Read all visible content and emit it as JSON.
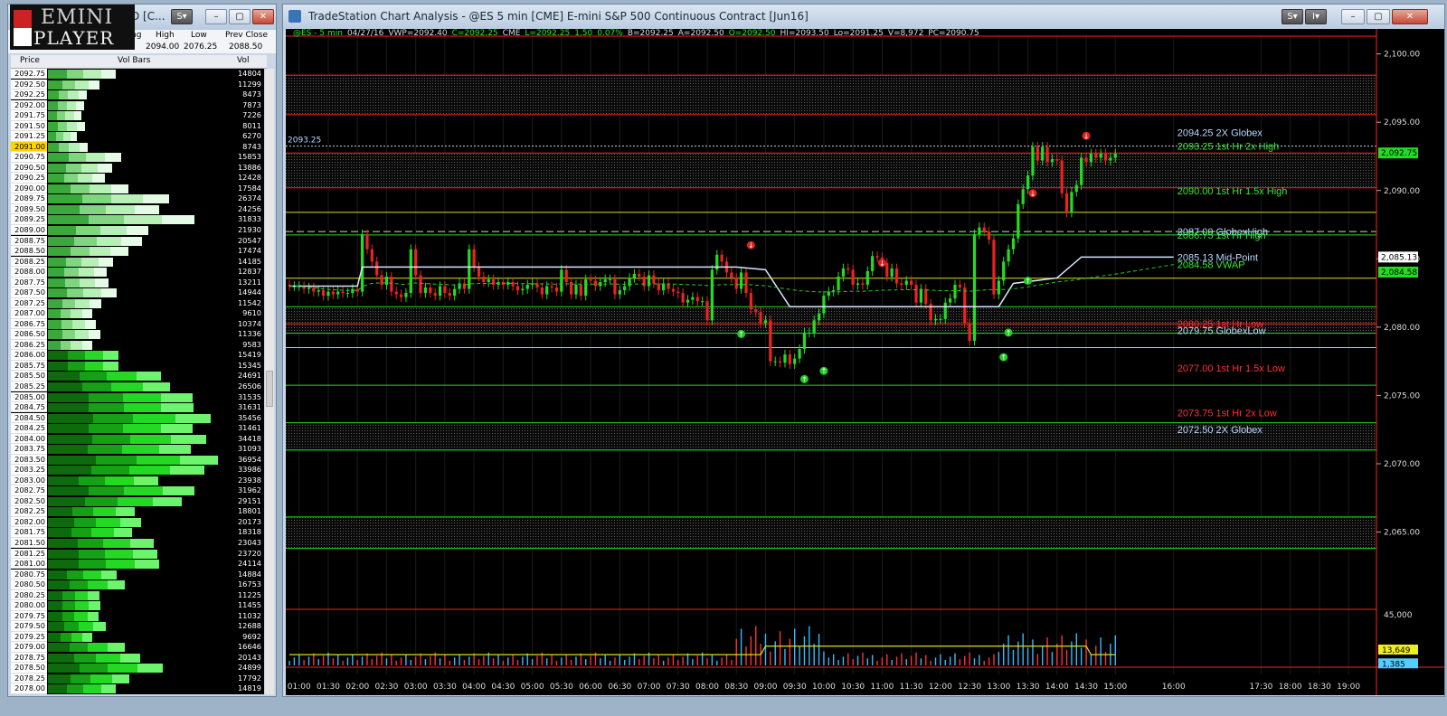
{
  "matrix_window": {
    "title_fragment": "D [C...",
    "logo": {
      "line1": "EMINI",
      "line2": "PLAYER"
    },
    "stats": {
      "chg_label": "hg",
      "high_label": "High",
      "low_label": "Low",
      "prev_label": "Prev Close",
      "high": "2094.00",
      "low": "2076.25",
      "prev": "2088.50"
    },
    "columns": {
      "price": "Price",
      "bars": "Vol Bars",
      "vol": "Vol"
    },
    "highlight_price": "2091.00",
    "rows": [
      [
        "2092.75",
        "14804"
      ],
      [
        "2092.50",
        "11299"
      ],
      [
        "2092.25",
        "8473"
      ],
      [
        "2092.00",
        "7873"
      ],
      [
        "2091.75",
        "7226"
      ],
      [
        "2091.50",
        "8011"
      ],
      [
        "2091.25",
        "6270"
      ],
      [
        "2091.00",
        "8743"
      ],
      [
        "2090.75",
        "15853"
      ],
      [
        "2090.50",
        "13886"
      ],
      [
        "2090.25",
        "12428"
      ],
      [
        "2090.00",
        "17584"
      ],
      [
        "2089.75",
        "26374"
      ],
      [
        "2089.50",
        "24256"
      ],
      [
        "2089.25",
        "31833"
      ],
      [
        "2089.00",
        "21930"
      ],
      [
        "2088.75",
        "20547"
      ],
      [
        "2088.50",
        "17474"
      ],
      [
        "2088.25",
        "14185"
      ],
      [
        "2088.00",
        "12837"
      ],
      [
        "2087.75",
        "13211"
      ],
      [
        "2087.50",
        "14944"
      ],
      [
        "2087.25",
        "11542"
      ],
      [
        "2087.00",
        "9610"
      ],
      [
        "2086.75",
        "10374"
      ],
      [
        "2086.50",
        "11336"
      ],
      [
        "2086.25",
        "9583"
      ],
      [
        "2086.00",
        "15419"
      ],
      [
        "2085.75",
        "15345"
      ],
      [
        "2085.50",
        "24691"
      ],
      [
        "2085.25",
        "26506"
      ],
      [
        "2085.00",
        "31535"
      ],
      [
        "2084.75",
        "31631"
      ],
      [
        "2084.50",
        "35456"
      ],
      [
        "2084.25",
        "31461"
      ],
      [
        "2084.00",
        "34418"
      ],
      [
        "2083.75",
        "31093"
      ],
      [
        "2083.50",
        "36954"
      ],
      [
        "2083.25",
        "33986"
      ],
      [
        "2083.00",
        "23938"
      ],
      [
        "2082.75",
        "31962"
      ],
      [
        "2082.50",
        "29151"
      ],
      [
        "2082.25",
        "18801"
      ],
      [
        "2082.00",
        "20173"
      ],
      [
        "2081.75",
        "18318"
      ],
      [
        "2081.50",
        "23043"
      ],
      [
        "2081.25",
        "23720"
      ],
      [
        "2081.00",
        "24114"
      ],
      [
        "2080.75",
        "14884"
      ],
      [
        "2080.50",
        "16753"
      ],
      [
        "2080.25",
        "11225"
      ],
      [
        "2080.00",
        "11455"
      ],
      [
        "2079.75",
        "11032"
      ],
      [
        "2079.50",
        "12688"
      ],
      [
        "2079.25",
        "9692"
      ],
      [
        "2079.00",
        "16646"
      ],
      [
        "2078.75",
        "20143"
      ],
      [
        "2078.50",
        "24899"
      ],
      [
        "2078.25",
        "17792"
      ],
      [
        "2078.00",
        "14819"
      ]
    ]
  },
  "chart_window": {
    "title": "TradeStation Chart Analysis - @ES 5 min [CME] E-mini S&P 500 Continuous Contract [Jun16]",
    "status_line": {
      "sym": "@ES - 5 min",
      "date": "04/27/16",
      "vwp": "VWP=2092.40",
      "c": "C=2092.25",
      "exch": "CME",
      "l": "L=2092.25",
      "chg": "1.50",
      "pct": "0.07%",
      "b": "B=2092.25",
      "a": "A=2092.50",
      "o": "O=2092.50",
      "hi": "HI=2093.50",
      "lo": "Lo=2091.25",
      "v": "V=8,972",
      "pc": "PC=2090.75"
    },
    "left_tag": "2093.25",
    "price_axis": [
      "2,100.00",
      "2,095.00",
      "2,090.00",
      "2,085.00",
      "2,080.00",
      "2,075.00",
      "2,070.00",
      "2,065.00"
    ],
    "price_tags": {
      "last": "2,092.75",
      "mid": "2,085.13",
      "vwap": "2,084.58"
    },
    "volume_axis": {
      "top": "45,000",
      "v1": "13,649",
      "v2": "1,385"
    },
    "time_axis": [
      "01:00",
      "01:30",
      "02:00",
      "02:30",
      "03:00",
      "03:30",
      "04:00",
      "04:30",
      "05:00",
      "05:30",
      "06:00",
      "06:30",
      "07:00",
      "07:30",
      "08:00",
      "08:30",
      "09:00",
      "09:30",
      "10:00",
      "10:30",
      "11:00",
      "11:30",
      "12:00",
      "12:30",
      "13:00",
      "13:30",
      "14:00",
      "14:30",
      "15:00",
      "16:00",
      "17:30",
      "18:00",
      "18:30",
      "19:00"
    ],
    "levels": [
      {
        "text": "2094.25 2X Globex",
        "color": "#b8d8ff"
      },
      {
        "text": "2093.25 1st Hr  2x High",
        "color": "#33ee33"
      },
      {
        "text": "2090.00 1st Hr  1.5x High",
        "color": "#33ee33"
      },
      {
        "text": "2087.00 GlobexHigh",
        "color": "#b8d8ff"
      },
      {
        "text": "2086.75 1st Hr  High",
        "color": "#33ee33"
      },
      {
        "text": "2085.13 Mid-Point",
        "color": "#b8d8ff"
      },
      {
        "text": "2084.58 VWAP",
        "color": "#33ee33"
      },
      {
        "text": "2080.25 1st Hr  Low",
        "color": "#ff3030"
      },
      {
        "text": "2079.75 GlobexLow",
        "color": "#b8d8ff"
      },
      {
        "text": "2077.00 1st Hr  1.5x Low",
        "color": "#ff3030"
      },
      {
        "text": "2073.75 1st Hr  2x Low",
        "color": "#ff3030"
      },
      {
        "text": "2072.50 2X Globex",
        "color": "#b8d8ff"
      }
    ]
  },
  "chart_data": {
    "type": "candlestick",
    "title": "TradeStation Chart Analysis - @ES 5 min [CME] E-mini S&P 500 Continuous Contract [Jun16]",
    "xlabel": "",
    "ylabel": "",
    "ylim": [
      2060.8,
      2101.3
    ],
    "x_range": [
      "00:50",
      "19:25"
    ],
    "bar_minutes": 5,
    "first_bar_time": "00:50",
    "last_bar_time": "15:10",
    "up_color": "#22dd22",
    "down_color": "#ee2222",
    "closes": [
      2083.0,
      2083.0,
      2083.0,
      2082.8,
      2082.9,
      2082.6,
      2082.7,
      2082.3,
      2082.6,
      2082.4,
      2082.6,
      2082.5,
      2082.5,
      2082.8,
      2082.6,
      2086.8,
      2085.7,
      2084.8,
      2083.8,
      2083.1,
      2083.7,
      2082.6,
      2082.4,
      2082.2,
      2082.5,
      2085.7,
      2083.8,
      2082.5,
      2082.9,
      2082.5,
      2082.3,
      2083.0,
      2082.5,
      2082.3,
      2082.8,
      2083.2,
      2082.8,
      2085.7,
      2084.4,
      2083.7,
      2083.3,
      2083.5,
      2083.1,
      2083.3,
      2083.1,
      2083.3,
      2083.0,
      2082.7,
      2082.8,
      2083.1,
      2083.2,
      2082.9,
      2082.4,
      2083.0,
      2082.9,
      2082.6,
      2084.2,
      2083.3,
      2082.4,
      2083.1,
      2082.3,
      2083.5,
      2083.4,
      2083.0,
      2083.3,
      2083.5,
      2083.5,
      2082.4,
      2082.7,
      2083.0,
      2083.6,
      2083.9,
      2083.7,
      2083.0,
      2083.8,
      2083.2,
      2082.7,
      2083.2,
      2082.8,
      2082.6,
      2082.5,
      2081.8,
      2082.0,
      2082.2,
      2081.9,
      2081.9,
      2080.5,
      2084.2,
      2085.3,
      2084.8,
      2084.0,
      2083.6,
      2082.8,
      2084.0,
      2082.5,
      2081.3,
      2081.1,
      2080.3,
      2080.5,
      2077.5,
      2077.5,
      2077.4,
      2078.0,
      2077.3,
      2077.7,
      2078.4,
      2079.6,
      2079.6,
      2080.5,
      2081.0,
      2082.3,
      2082.6,
      2082.7,
      2083.7,
      2084.3,
      2084.2,
      2083.1,
      2083.2,
      2083.1,
      2084.1,
      2085.2,
      2085.1,
      2084.7,
      2083.7,
      2084.3,
      2083.2,
      2083.1,
      2083.4,
      2083.1,
      2081.8,
      2082.8,
      2081.7,
      2080.5,
      2080.6,
      2080.6,
      2081.8,
      2082.1,
      2083.1,
      2082.9,
      2080.3,
      2079.0,
      2086.8,
      2087.3,
      2087.0,
      2086.4,
      2082.4,
      2083.4,
      2084.8,
      2085.7,
      2086.5,
      2089.0,
      2090.1,
      2091.1,
      2093.2,
      2092.2,
      2093.2,
      2092.1,
      2092.3,
      2092.2,
      2089.8,
      2088.4,
      2089.9,
      2090.4,
      2092.4,
      2092.1,
      2092.7,
      2092.4,
      2092.7,
      2092.2,
      2092.4,
      2092.7
    ],
    "levels": [
      {
        "label": "2094.25 2X Globex",
        "value": 2094.25
      },
      {
        "label": "2093.25 1st Hr  2x High",
        "value": 2093.25
      },
      {
        "label": "2090.00 1st Hr  1.5x High",
        "value": 2090.0
      },
      {
        "label": "2087.00 GlobexHigh",
        "value": 2087.0
      },
      {
        "label": "2086.75 1st Hr  High",
        "value": 2086.75
      },
      {
        "label": "2085.13 Mid-Point",
        "value": 2085.13
      },
      {
        "label": "2084.58 VWAP",
        "value": 2084.58
      },
      {
        "label": "2080.25 1st Hr  Low",
        "value": 2080.25
      },
      {
        "label": "2079.75 GlobexLow",
        "value": 2079.75
      },
      {
        "label": "2077.00 1st Hr  1.5x Low",
        "value": 2077.0
      },
      {
        "label": "2073.75 1st Hr  2x Low",
        "value": 2073.75
      },
      {
        "label": "2072.50 2X Globex",
        "value": 2072.5
      }
    ],
    "volume_ylim": [
      0,
      45000
    ],
    "volume_axis_values": [
      45000,
      13649,
      1385
    ]
  }
}
